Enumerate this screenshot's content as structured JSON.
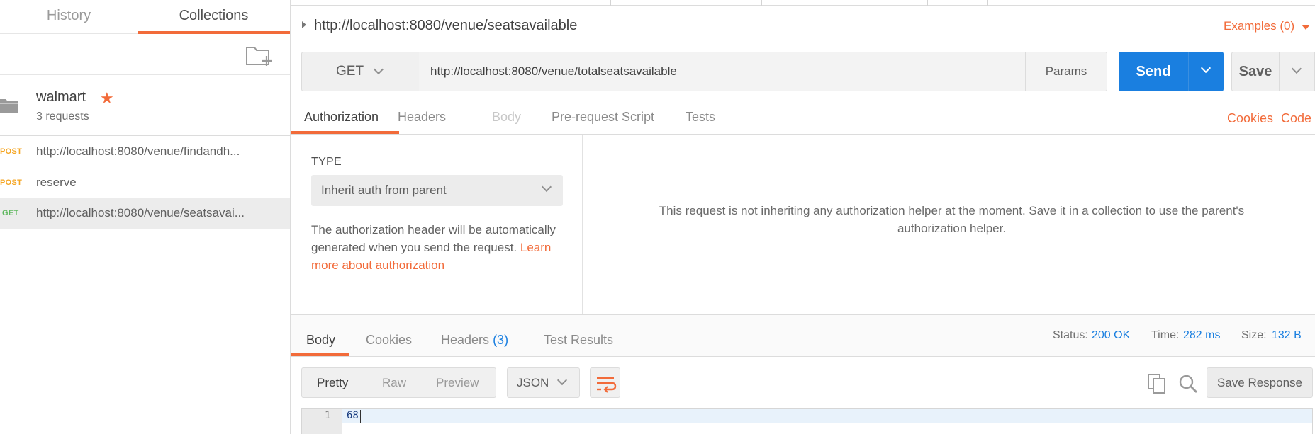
{
  "sidebar": {
    "tabs": [
      {
        "label": "History"
      },
      {
        "label": "Collections"
      }
    ],
    "collection": {
      "name": "walmart",
      "count": "3 requests"
    },
    "requests": [
      {
        "method": "POST",
        "name": "http://localhost:8080/venue/findandh..."
      },
      {
        "method": "POST",
        "name": "reserve"
      },
      {
        "method": "GET",
        "name": "http://localhost:8080/venue/seatsavai..."
      }
    ]
  },
  "request": {
    "title": "http://localhost:8080/venue/seatsavailable",
    "examples": "Examples (0)",
    "method": "GET",
    "url": "http://localhost:8080/venue/totalseatsavailable",
    "params_label": "Params",
    "send_label": "Send",
    "save_label": "Save",
    "tabs": [
      "Authorization",
      "Headers",
      "Body",
      "Pre-request Script",
      "Tests"
    ],
    "cookies_link": "Cookies",
    "code_link": "Code"
  },
  "auth": {
    "type_label": "TYPE",
    "type_value": "Inherit auth from parent",
    "desc_prefix": "The authorization header will be automatically generated when you send the request. ",
    "learn_more": "Learn more about authorization",
    "message": "This request is not inheriting any authorization helper at the moment. Save it in a collection to use the parent's authorization helper."
  },
  "response": {
    "tabs": {
      "body": "Body",
      "cookies": "Cookies",
      "headers": "Headers",
      "headers_count": "(3)",
      "test_results": "Test Results"
    },
    "status_label": "Status:",
    "status_value": "200 OK",
    "time_label": "Time:",
    "time_value": "282 ms",
    "size_label": "Size:",
    "size_value": "132 B",
    "formats": [
      "Pretty",
      "Raw",
      "Preview"
    ],
    "language": "JSON",
    "save_response_label": "Save Response",
    "body_lines": [
      {
        "no": "1",
        "text": "68"
      }
    ]
  },
  "colors": {
    "accent": "#f26b3a",
    "primary": "#1a7fe0",
    "post": "#f5a623",
    "get": "#5fb85f"
  }
}
